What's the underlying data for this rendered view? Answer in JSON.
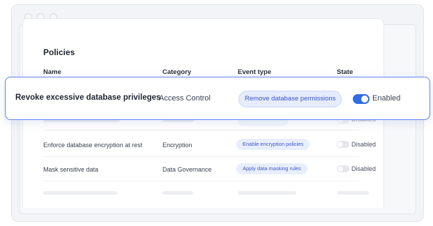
{
  "panel": {
    "title": "Policies"
  },
  "columns": {
    "name": "Name",
    "category": "Category",
    "event_type": "Event type",
    "state": "State"
  },
  "highlighted_row": {
    "name": "Revoke excessive database privileges",
    "category": "Access Control",
    "event_type": "Remove database permissions",
    "state": "Enabled",
    "enabled": true
  },
  "ghost_row": {
    "state": "Disabled"
  },
  "rows": [
    {
      "name": "Enforce database encryption at rest",
      "category": "Encryption",
      "event_type": "Enable encryption policies",
      "state": "Disabled",
      "enabled": false
    },
    {
      "name": "Mask sensitive data",
      "category": "Data Governance",
      "event_type": "Apply data masking rules",
      "state": "Disabled",
      "enabled": false
    }
  ],
  "colors": {
    "accent": "#2f6ce5",
    "pill_bg": "#e8eefc",
    "pill_text": "#3a57c8",
    "highlight_border": "#5b86f0"
  }
}
